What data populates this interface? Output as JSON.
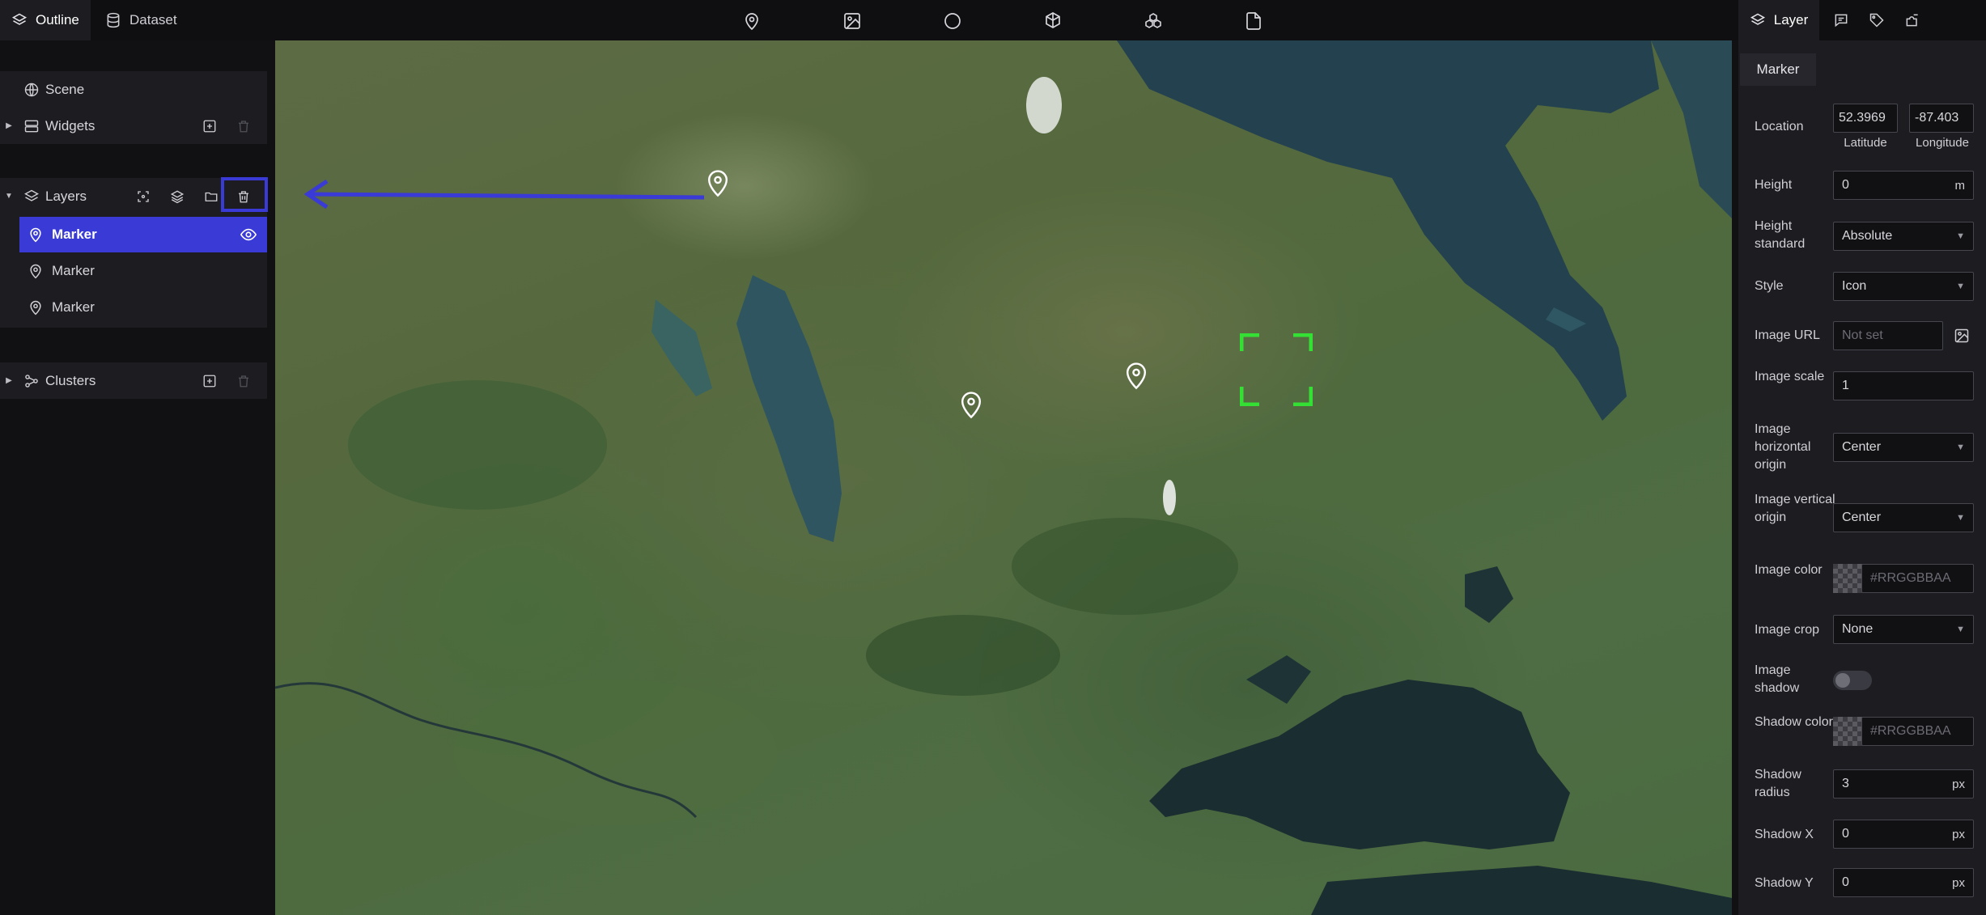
{
  "top_tabs": [
    {
      "label": "Outline",
      "icon": "layers-icon"
    },
    {
      "label": "Dataset",
      "icon": "database-icon"
    }
  ],
  "toolbar": [
    "marker-tool-icon",
    "image-tool-icon",
    "circle-tool-icon",
    "model-tool-icon",
    "tileset-tool-icon",
    "file-tool-icon"
  ],
  "outline": {
    "scene_label": "Scene",
    "widgets_label": "Widgets",
    "layers_label": "Layers",
    "layer_items": [
      "Marker",
      "Marker",
      "Marker"
    ],
    "clusters_label": "Clusters"
  },
  "right_tabs": [
    {
      "label": "Layer",
      "icon": "layers-icon"
    },
    {
      "label": "",
      "icon": "infobox-icon"
    },
    {
      "label": "",
      "icon": "tag-icon"
    },
    {
      "label": "",
      "icon": "plugin-icon"
    }
  ],
  "inspector": {
    "subtab": "Marker",
    "location_label": "Location",
    "latitude_value": "52.3969",
    "longitude_value": "-87.403",
    "latitude_label": "Latitude",
    "longitude_label": "Longitude",
    "height_label": "Height",
    "height_value": "0",
    "height_unit": "m",
    "height_standard_label": "Height standard",
    "height_standard_value": "Absolute",
    "style_label": "Style",
    "style_value": "Icon",
    "image_url_label": "Image URL",
    "image_url_placeholder": "Not set",
    "image_scale_label": "Image scale",
    "image_scale_value": "1",
    "image_h_origin_label": "Image horizontal origin",
    "image_h_origin_value": "Center",
    "image_v_origin_label": "Image vertical origin",
    "image_v_origin_value": "Center",
    "image_color_label": "Image color",
    "image_color_placeholder": "#RRGGBBAA",
    "image_crop_label": "Image crop",
    "image_crop_value": "None",
    "image_shadow_label": "Image shadow",
    "image_shadow_on": false,
    "shadow_color_label": "Shadow color",
    "shadow_color_placeholder": "#RRGGBBAA",
    "shadow_radius_label": "Shadow radius",
    "shadow_radius_value": "3",
    "shadow_x_label": "Shadow X",
    "shadow_x_value": "0",
    "shadow_y_label": "Shadow Y",
    "shadow_y_value": "0",
    "px_unit": "px"
  },
  "colors": {
    "accent": "#3a3ad6",
    "selection_box": "#33e033",
    "panel_bg": "#1c1c21",
    "app_bg": "#111114"
  }
}
